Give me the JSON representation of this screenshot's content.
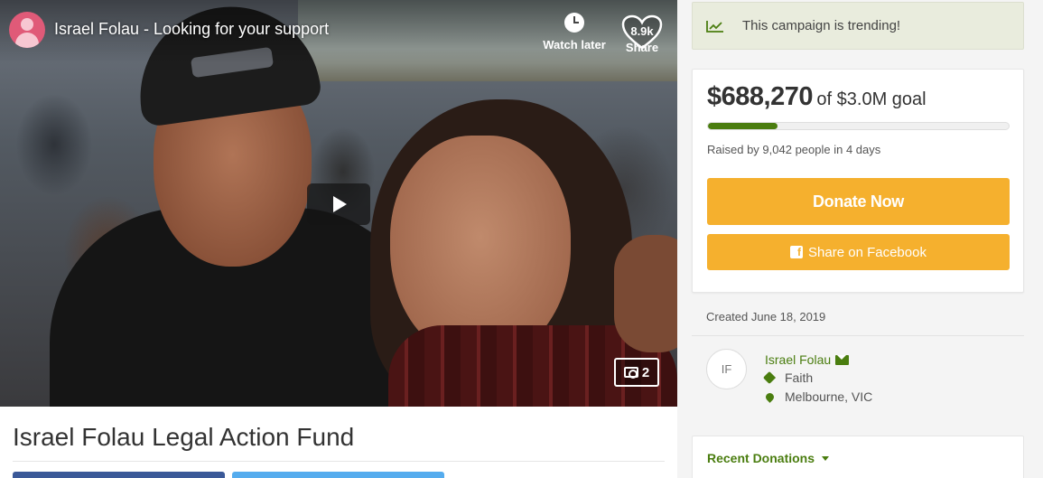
{
  "video": {
    "title": "Israel Folau - Looking for your support",
    "watch_later_label": "Watch later",
    "share_count": "8.9k",
    "share_label": "Share",
    "photo_count": "2"
  },
  "campaign": {
    "title": "Israel Folau Legal Action Fund"
  },
  "sidebar": {
    "trending_text": "This campaign is trending!",
    "raised_amount": "$688,270",
    "goal_text": "of $3.0M goal",
    "progress_fraction": 0.23,
    "raised_by": "Raised by 9,042 people in 4 days",
    "donate_label": "Donate Now",
    "share_facebook_label": "Share on Facebook",
    "created": "Created June 18, 2019",
    "organizer": {
      "initials": "IF",
      "name": "Israel Folau",
      "category": "Faith",
      "location": "Melbourne, VIC"
    },
    "recent_donations_label": "Recent Donations"
  },
  "colors": {
    "accent_green": "#4a7d0f",
    "donate_orange": "#f5b02e",
    "facebook_blue": "#3b5998",
    "twitter_blue": "#55acee",
    "trending_bg": "#e9ecdd"
  }
}
